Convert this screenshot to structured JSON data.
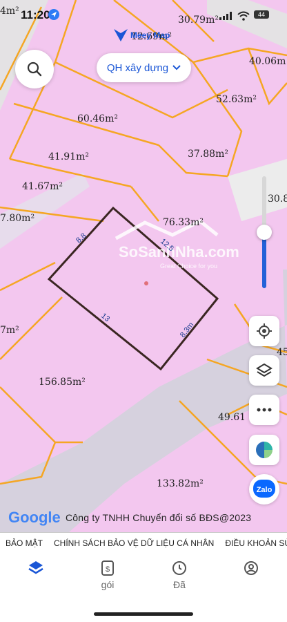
{
  "status_bar": {
    "time": "11:20",
    "battery": "44"
  },
  "app": {
    "logo_text": "Meey Map"
  },
  "layer_button": {
    "label": "QH xây dựng"
  },
  "map": {
    "parcels": [
      {
        "area": "30.79m²"
      },
      {
        "area": "12.69m²"
      },
      {
        "area": "40.06m"
      },
      {
        "area": "4m²"
      },
      {
        "area": "52.63m²"
      },
      {
        "area": "60.46m²"
      },
      {
        "area": "41.91m²"
      },
      {
        "area": "37.88m²"
      },
      {
        "area": "41.67m²"
      },
      {
        "area": "30.8"
      },
      {
        "area": "7.80m²"
      },
      {
        "area": "76.33m²"
      },
      {
        "area": "7m²"
      },
      {
        "area": "45"
      },
      {
        "area": "156.85m²"
      },
      {
        "area": "49.61"
      },
      {
        "area": "133.82m²"
      }
    ],
    "selected_edges": [
      "8.8",
      "12.5",
      "13",
      "8.3m"
    ],
    "watermark": {
      "brand": "SoSanhNha.com",
      "tagline": "Great Choice for you"
    }
  },
  "google_logo": "Google",
  "copyright": "Công ty TNHH Chuyển đổi số BĐS@2023",
  "policy_links": [
    "BẢO MẬT",
    "CHÍNH SÁCH BẢO VỆ DỮ LIỆU CÁ NHÂN",
    "ĐIỀU KHOẢN SỬ"
  ],
  "tabs": [
    {
      "label": "",
      "icon": "layers-icon"
    },
    {
      "label": "gói",
      "icon": "price-tag-icon"
    },
    {
      "label": "Đã",
      "icon": "clock-icon"
    },
    {
      "label": "",
      "icon": "user-icon"
    }
  ],
  "colors": {
    "parcel": "#f3c7ef",
    "boundary": "#f5a623",
    "road": "#d9d2e3",
    "accent": "#1a56d6"
  }
}
